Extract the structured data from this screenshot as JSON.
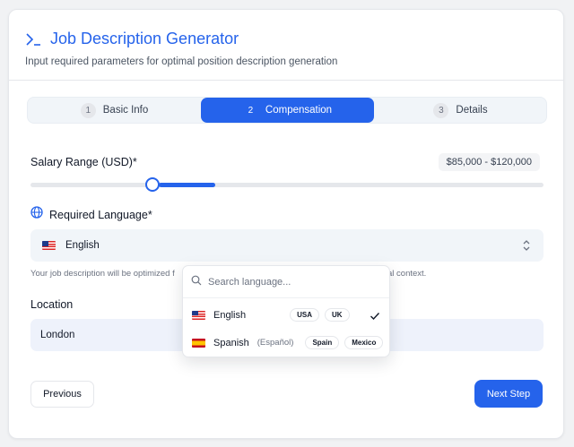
{
  "header": {
    "title": "Job Description Generator",
    "subtitle": "Input required parameters for optimal position description generation",
    "icon": "terminal-prompt-icon"
  },
  "steps": [
    {
      "number": "1",
      "label": "Basic Info",
      "active": false
    },
    {
      "number": "2",
      "label": "Compensation",
      "active": true
    },
    {
      "number": "3",
      "label": "Details",
      "active": false
    }
  ],
  "salary": {
    "label": "Salary Range (USD)*",
    "value_text": "$85,000 - $120,000",
    "slider_fill_fraction": 0.36
  },
  "language": {
    "label": "Required Language*",
    "selected": "English",
    "selected_flag": "flag-us",
    "helper_start": "Your job description will be optimized f",
    "helper_end": "al context."
  },
  "dropdown": {
    "search_placeholder": "Search language...",
    "options": [
      {
        "name": "English",
        "native": "",
        "flag": "flag-us",
        "tags": [
          "USA",
          "UK"
        ],
        "selected": true
      },
      {
        "name": "Spanish",
        "native": "(Español)",
        "flag": "flag-es",
        "tags": [
          "Spain",
          "Mexico"
        ],
        "selected": false
      }
    ]
  },
  "location": {
    "label": "Location",
    "value": "London"
  },
  "buttons": {
    "previous": "Previous",
    "next": "Next Step"
  },
  "colors": {
    "accent": "#2563eb",
    "background": "#f1f2f4",
    "input_bg": "#f1f5f9"
  }
}
